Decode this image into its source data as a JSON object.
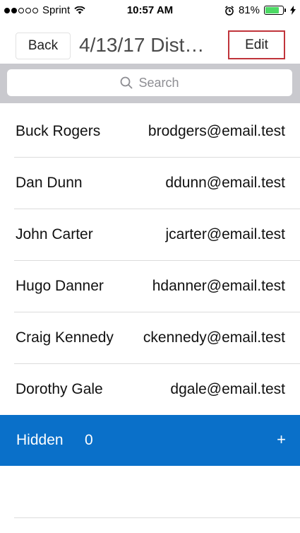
{
  "status_bar": {
    "carrier": "Sprint",
    "time": "10:57 AM",
    "battery": "81%",
    "battery_color": "#4cd964"
  },
  "nav": {
    "back_label": "Back",
    "title": "4/13/17 Dist…",
    "edit_label": "Edit"
  },
  "search": {
    "placeholder": "Search",
    "icon": "search-icon"
  },
  "contacts": [
    {
      "name": "Buck Rogers",
      "email": "brodgers@email.test"
    },
    {
      "name": "Dan Dunn",
      "email": "ddunn@email.test"
    },
    {
      "name": "John Carter",
      "email": "jcarter@email.test"
    },
    {
      "name": "Hugo Danner",
      "email": "hdanner@email.test"
    },
    {
      "name": "Craig Kennedy",
      "email": "ckennedy@email.test"
    },
    {
      "name": "Dorothy Gale",
      "email": "dgale@email.test"
    }
  ],
  "hidden_section": {
    "label": "Hidden",
    "count": "0",
    "add_symbol": "+",
    "color": "#0a70c9"
  }
}
